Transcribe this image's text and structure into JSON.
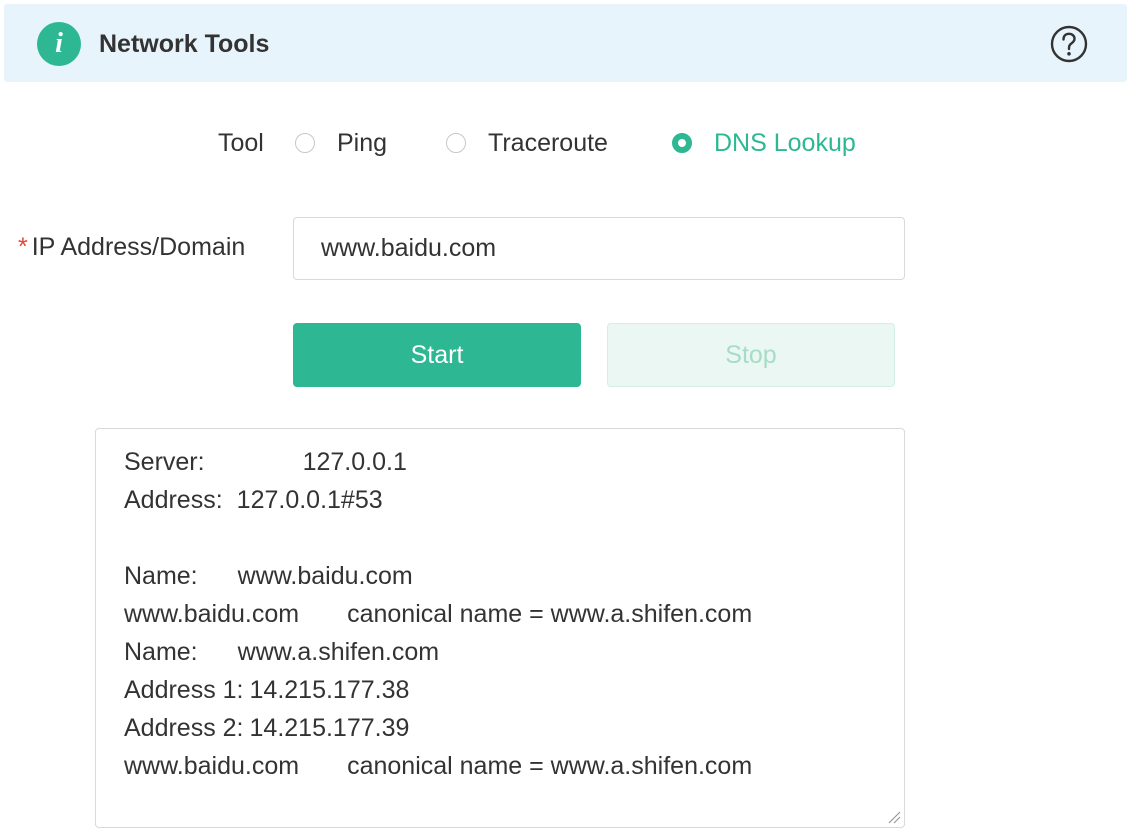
{
  "header": {
    "title": "Network Tools",
    "info_icon": "info-icon",
    "help_icon": "help-circle-icon",
    "info_glyph": "i"
  },
  "tool": {
    "label": "Tool",
    "options": [
      {
        "label": "Ping",
        "checked": false
      },
      {
        "label": "Traceroute",
        "checked": false
      },
      {
        "label": "DNS Lookup",
        "checked": true
      }
    ]
  },
  "form": {
    "required_mark": "*",
    "address_label": "IP Address/Domain",
    "address_value": "www.baidu.com"
  },
  "buttons": {
    "start_label": "Start",
    "stop_label": "Stop"
  },
  "output": {
    "lines": [
      {
        "a": "Server:",
        "b": "127.0.0.1"
      },
      {
        "a": "Address:",
        "b": "127.0.0.1#53"
      },
      {
        "a": "",
        "b": ""
      },
      {
        "a": "Name:",
        "b": "www.baidu.com"
      },
      {
        "a": "www.baidu.com",
        "b": "canonical name = www.a.shifen.com"
      },
      {
        "a": "Name:",
        "b": "www.a.shifen.com"
      },
      {
        "a": "Address 1:",
        "b": "14.215.177.38"
      },
      {
        "a": "Address 2:",
        "b": "14.215.177.39"
      },
      {
        "a": "www.baidu.com",
        "b": "canonical name = www.a.shifen.com"
      }
    ]
  },
  "colors": {
    "accent": "#2db893",
    "header_bg": "#e8f4fc",
    "required": "#e5463a"
  }
}
